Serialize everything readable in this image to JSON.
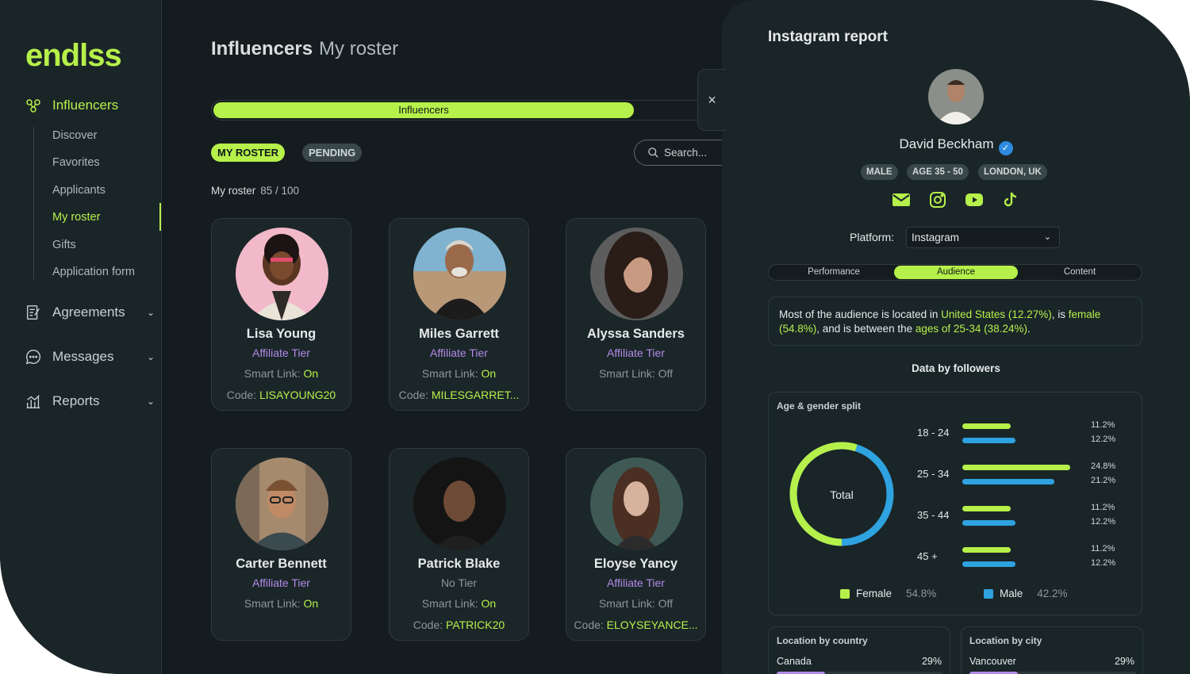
{
  "app": {
    "logo": "endlss"
  },
  "sidebar": {
    "influencers": "Influencers",
    "sub_items": [
      "Discover",
      "Favorites",
      "Applicants",
      "My roster",
      "Gifts",
      "Application form"
    ],
    "agreements": "Agreements",
    "messages": "Messages",
    "reports": "Reports"
  },
  "main": {
    "title_bold": "Influencers",
    "title_sub": "My roster",
    "tab_active": "Influencers",
    "pill_roster": "MY ROSTER",
    "pill_pending": "PENDING",
    "search_placeholder": "Search...",
    "roster_label": "My roster",
    "roster_count": "85 / 100",
    "cards": [
      {
        "name": "Lisa Young",
        "tier": "Affiliate Tier",
        "smart_prefix": "Smart Link: ",
        "smart_value": "On",
        "code_prefix": "Code: ",
        "code_value": "LISAYOUNG20"
      },
      {
        "name": "Miles Garrett",
        "tier": "Affiliate Tier",
        "smart_prefix": "Smart Link: ",
        "smart_value": "On",
        "code_prefix": "Code: ",
        "code_value": "MILESGARRET..."
      },
      {
        "name": "Alyssa Sanders",
        "tier": "Affiliate Tier",
        "smart_prefix": "Smart Link: ",
        "smart_value": "Off"
      },
      {
        "name": "Carter Bennett",
        "tier": "Affiliate Tier",
        "smart_prefix": "Smart Link: ",
        "smart_value": "On"
      },
      {
        "name": "Patrick Blake",
        "tier": "No Tier",
        "smart_prefix": "Smart Link: ",
        "smart_value": "On",
        "code_prefix": "Code: ",
        "code_value": "PATRICK20"
      },
      {
        "name": "Eloyse Yancy",
        "tier": "Affiliate Tier",
        "smart_prefix": "Smart Link: ",
        "smart_value": "Off",
        "code_prefix": "Code: ",
        "code_value": "ELOYSEYANCE..."
      }
    ]
  },
  "panel": {
    "title": "Instagram report",
    "close": "×",
    "name": "David Beckham",
    "tags": [
      "MALE",
      "AGE 35 - 50",
      "LONDON, UK"
    ],
    "socials": [
      "mail-icon",
      "instagram-icon",
      "youtube-icon",
      "tiktok-icon"
    ],
    "platform_label": "Platform:",
    "platform_value": "Instagram",
    "tabs": [
      "Performance",
      "Audience",
      "Content"
    ],
    "summary": {
      "t1": "Most of the audience is located in ",
      "h1": "United States (12.27%)",
      "t2": ", is ",
      "h2": "female (54.8%)",
      "t3": ", and is between the ",
      "h3": "ages of 25-34 (38.24%)",
      "t4": "."
    },
    "by_followers": "Data by followers",
    "age_title": "Age & gender split",
    "donut_label": "Total",
    "age_groups": [
      {
        "label": "18 - 24",
        "female": "11.2%",
        "male": "12.2%",
        "female_value": 11.2,
        "male_value": 12.2
      },
      {
        "label": "25 - 34",
        "female": "24.8%",
        "male": "21.2%",
        "female_value": 24.8,
        "male_value": 21.2
      },
      {
        "label": "35 - 44",
        "female": "11.2%",
        "male": "12.2%",
        "female_value": 11.2,
        "male_value": 12.2
      },
      {
        "label": "45 +",
        "female": "11.2%",
        "male": "12.2%",
        "female_value": 11.2,
        "male_value": 12.2
      }
    ],
    "legend": {
      "female": "Female",
      "female_pct": "54.8%",
      "male": "Male",
      "male_pct": "42.2%",
      "female_share": 54.8,
      "male_share": 42.2
    },
    "location_country": {
      "title": "Location by country",
      "name": "Canada",
      "pct": "29%",
      "value": 29
    },
    "location_city": {
      "title": "Location by city",
      "name": "Vancouver",
      "pct": "29%",
      "value": 29
    }
  },
  "colors": {
    "accent": "#b6f04a",
    "male": "#2ea3e0",
    "tier": "#b18ae6",
    "panel_bg": "#1a2528",
    "app_bg": "#151c1f"
  }
}
